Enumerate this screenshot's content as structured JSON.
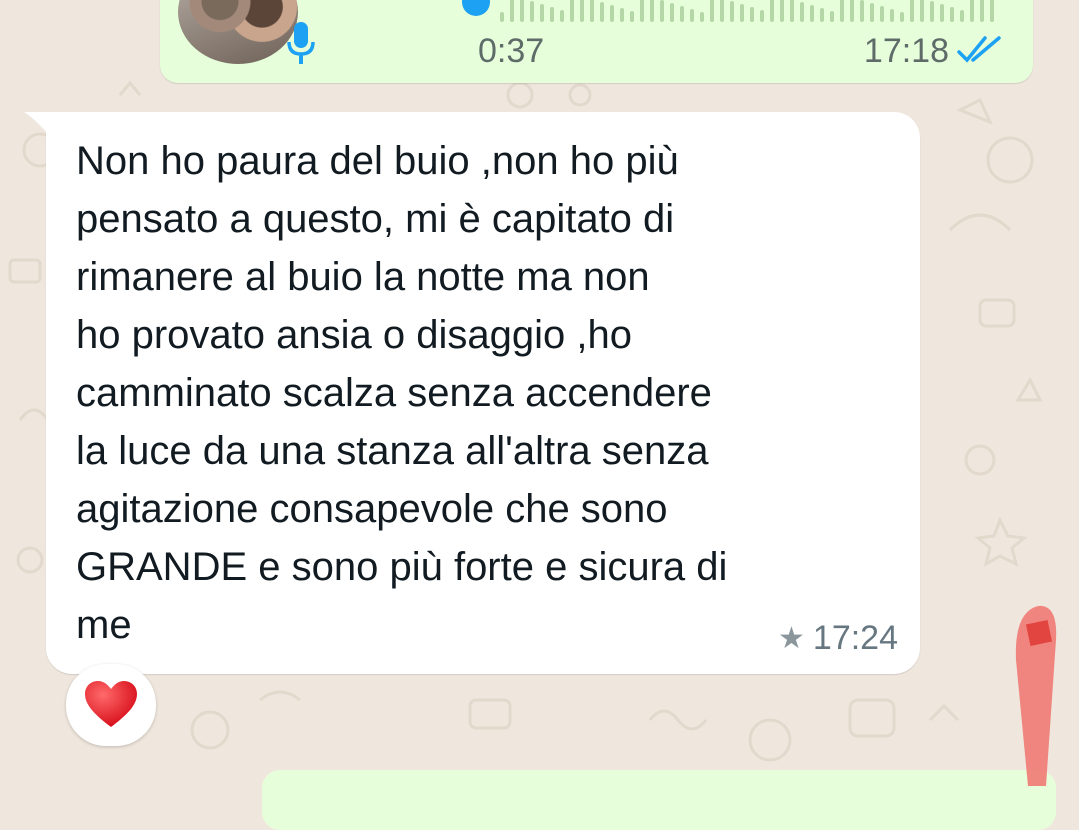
{
  "voice_message": {
    "duration": "0:37",
    "time": "17:18",
    "status": "read",
    "icons": [
      "avatar",
      "mic-icon",
      "play-icon",
      "waveform",
      "double-check-icon"
    ],
    "accent_color": "#1da1f2"
  },
  "message": {
    "text": "Non ho paura del buio ,non ho più\npensato a questo, mi è capitato di\nrimanere al buio la notte ma non\nho provato ansia o disaggio ,ho\ncamminato scalza senza accendere\nla luce da una stanza all'altra  senza\nagitazione consapevole che sono\nGRANDE e sono più forte e sicura di\nme",
    "starred_icon": "★",
    "time": "17:24"
  },
  "reaction": {
    "emoji": "heart-icon",
    "color": "#e0202a"
  },
  "colors": {
    "chat_background": "#efe7dd",
    "outgoing_bubble": "#e6ffda",
    "incoming_bubble": "#ffffff",
    "annotation": "#f07a74"
  }
}
